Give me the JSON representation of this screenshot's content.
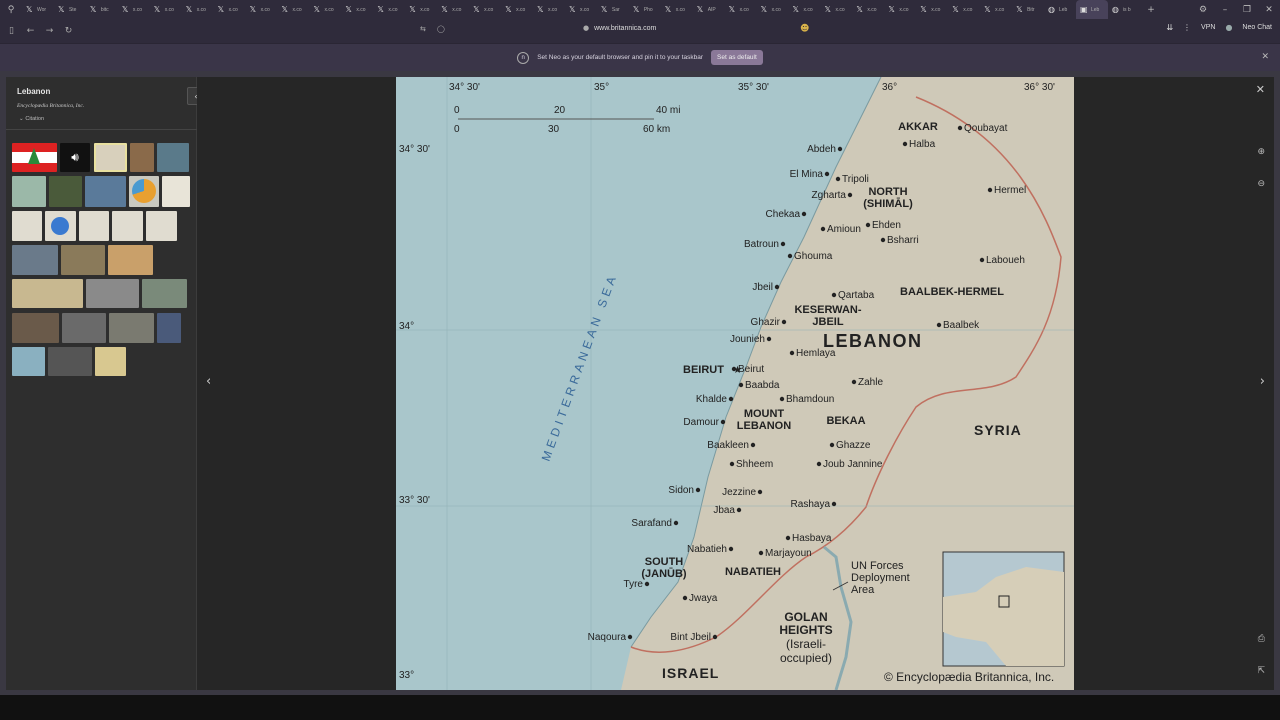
{
  "browser": {
    "tabs": [
      {
        "icon": "x-icon",
        "label": "Wor"
      },
      {
        "icon": "x-icon",
        "label": "Ste"
      },
      {
        "icon": "x-icon",
        "label": "bitc"
      },
      {
        "icon": "x-icon",
        "label": "x.co"
      },
      {
        "icon": "x-icon",
        "label": "x.co"
      },
      {
        "icon": "x-icon",
        "label": "x.co"
      },
      {
        "icon": "x-icon",
        "label": "x.co"
      },
      {
        "icon": "x-icon",
        "label": "x.co"
      },
      {
        "icon": "x-icon",
        "label": "x.co"
      },
      {
        "icon": "x-icon",
        "label": "x.co"
      },
      {
        "icon": "x-icon",
        "label": "x.co"
      },
      {
        "icon": "x-icon",
        "label": "x.co"
      },
      {
        "icon": "x-icon",
        "label": "x.co"
      },
      {
        "icon": "x-icon",
        "label": "x.co"
      },
      {
        "icon": "x-icon",
        "label": "x.co"
      },
      {
        "icon": "x-icon",
        "label": "x.co"
      },
      {
        "icon": "x-icon",
        "label": "x.co"
      },
      {
        "icon": "x-icon",
        "label": "x.co"
      },
      {
        "icon": "x-icon",
        "label": "Sar"
      },
      {
        "icon": "x-icon",
        "label": "Pho"
      },
      {
        "icon": "x-icon",
        "label": "x.co"
      },
      {
        "icon": "x-icon",
        "label": "AIP"
      },
      {
        "icon": "x-icon",
        "label": "x.co"
      },
      {
        "icon": "x-icon",
        "label": "x.co"
      },
      {
        "icon": "x-icon",
        "label": "x.co"
      },
      {
        "icon": "x-icon",
        "label": "x.co"
      },
      {
        "icon": "x-icon",
        "label": "x.co"
      },
      {
        "icon": "x-icon",
        "label": "x.co"
      },
      {
        "icon": "x-icon",
        "label": "x.co"
      },
      {
        "icon": "x-icon",
        "label": "x.co"
      },
      {
        "icon": "x-icon",
        "label": "x.co"
      },
      {
        "icon": "x-icon",
        "label": "Bitr"
      },
      {
        "icon": "globe-icon",
        "label": "Leb"
      },
      {
        "icon": "britannica-icon",
        "label": "Leb"
      },
      {
        "icon": "globe-icon",
        "label": "is b"
      }
    ],
    "url": "www.britannica.com",
    "vpn_label": "VPN",
    "profile_label": "Neo Chat"
  },
  "notification": {
    "message": "Set Neo as your default browser and pin it to your taskbar",
    "button_label": "Set as default"
  },
  "sidebar": {
    "title": "Lebanon",
    "source": "Encyclopædia Britannica, Inc.",
    "citation_label": "Citation"
  },
  "map": {
    "top_lon_labels": [
      "34° 30'",
      "35°",
      "35° 30'",
      "36°",
      "36° 30'"
    ],
    "lat_labels": [
      "34° 30'",
      "34°",
      "33° 30'",
      "33°"
    ],
    "scale": {
      "mi": [
        "0",
        "20",
        "40 mi"
      ],
      "km": [
        "0",
        "30",
        "60 km"
      ]
    },
    "sea_label": "MEDITERRANEAN SEA",
    "country_label": "LEBANON",
    "neighbors": [
      "SYRIA",
      "ISRAEL"
    ],
    "regions": [
      "AKKAR",
      "NORTH",
      "(SHIMĀL)",
      "BAALBEK-HERMEL",
      "KESERWAN-",
      "JBEIL",
      "MOUNT",
      "LEBANON",
      "BEKAA",
      "SOUTH",
      "(JANŪB)",
      "NABATIEH",
      "GOLAN",
      "HEIGHTS",
      "(Israeli-",
      "occupied)"
    ],
    "capital": "BEIRUT",
    "cities": [
      "Abdeh",
      "Halba",
      "Qoubayat",
      "El Mina",
      "Tripoli",
      "Zgharta",
      "Hermel",
      "Chekaa",
      "Ehden",
      "Amioun",
      "Bsharri",
      "Batroun",
      "Ghouma",
      "Laboueh",
      "Jbeil",
      "Qartaba",
      "Ghazir",
      "Baalbek",
      "Jounieh",
      "Hemlaya",
      "Beirut",
      "Baabda",
      "Zahle",
      "Khalde",
      "Bhamdoun",
      "Damour",
      "Ghazze",
      "Baakleen",
      "Shheem",
      "Joub Jannine",
      "Sidon",
      "Jezzine",
      "Rashaya",
      "Sarafand",
      "Jbaa",
      "Hasbaya",
      "Nabatieh",
      "Marjayoun",
      "Tyre",
      "Jwaya",
      "Naqoura",
      "Bint Jbeil"
    ],
    "un_label": [
      "UN Forces",
      "Deployment",
      "Area"
    ],
    "copyright": "© Encyclopædia Britannica, Inc."
  }
}
